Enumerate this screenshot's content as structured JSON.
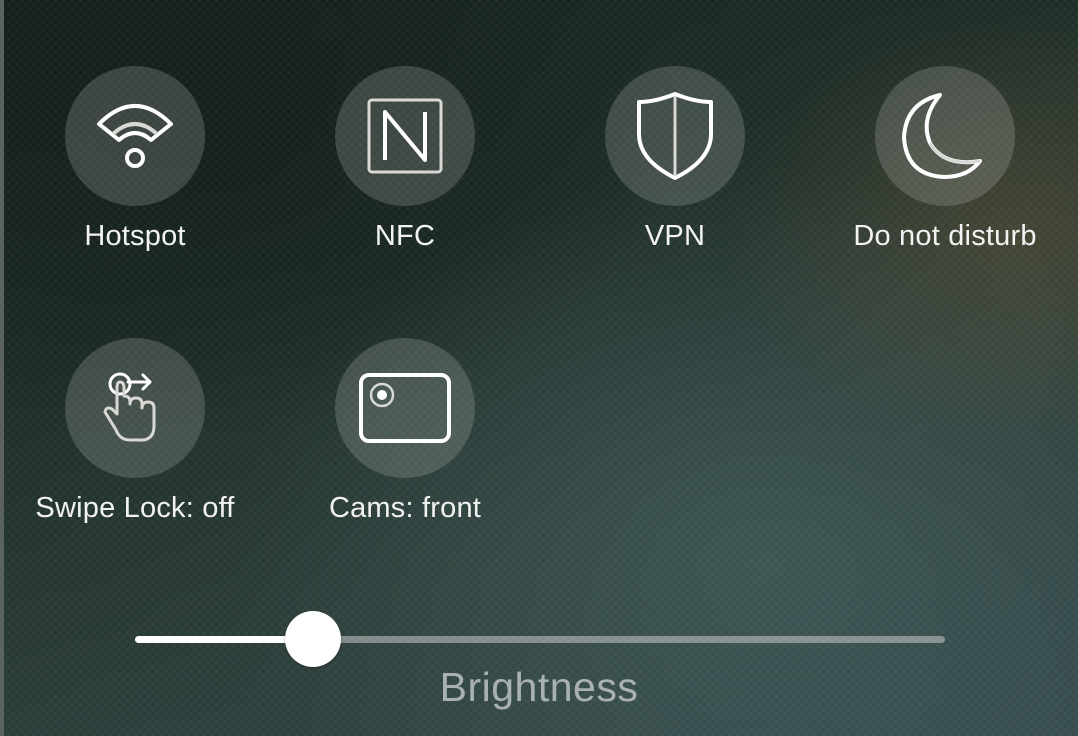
{
  "tiles": [
    {
      "label": "Hotspot",
      "icon": "hotspot-icon"
    },
    {
      "label": "NFC",
      "icon": "nfc-icon"
    },
    {
      "label": "VPN",
      "icon": "vpn-shield-icon"
    },
    {
      "label": "Do not disturb",
      "icon": "moon-icon"
    },
    {
      "label": "Swipe Lock: off",
      "icon": "swipe-lock-icon"
    },
    {
      "label": "Cams: front",
      "icon": "front-camera-icon"
    }
  ],
  "brightness": {
    "label": "Brightness",
    "level": 0.22
  },
  "colors": {
    "tile_background": "#c8c8c3",
    "label_text": "#f2f2f2",
    "slider_fill": "#ffffff",
    "brightness_text": "#a9b1b0"
  }
}
